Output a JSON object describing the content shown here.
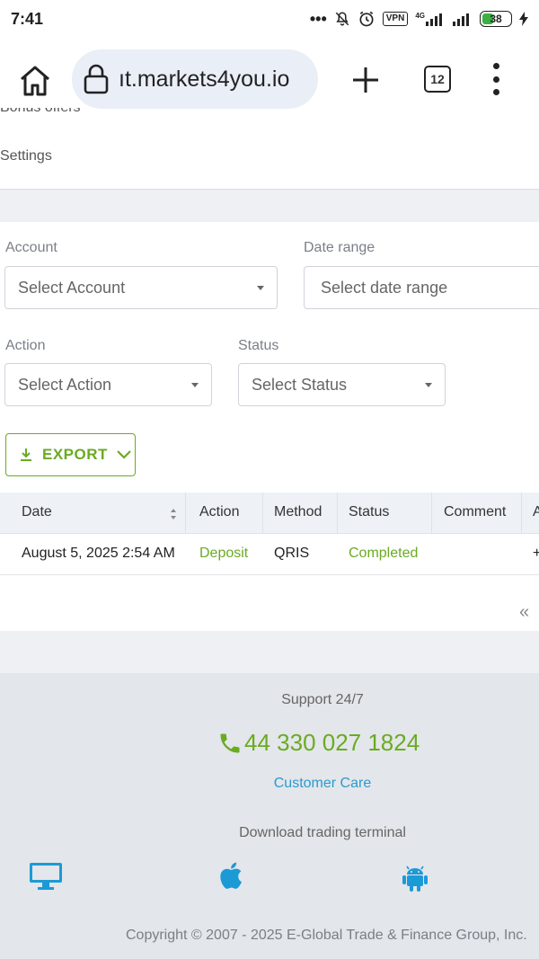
{
  "status_bar": {
    "time": "7:41",
    "icons": [
      "more-dots-icon",
      "bell-off-icon",
      "alarm-icon",
      "vpn-icon",
      "signal-4g-icon",
      "signal-icon",
      "battery-icon",
      "charging-icon"
    ],
    "vpn": "VPN",
    "network": "4G",
    "battery": "38"
  },
  "browser": {
    "url": "ıt.markets4you.io",
    "tab_count": "12"
  },
  "nav": {
    "bonus_partial": "Bonus offers",
    "settings": "Settings"
  },
  "filters": {
    "account_label": "Account",
    "account_value": "Select Account",
    "date_label": "Date range",
    "date_placeholder": "Select date range",
    "action_label": "Action",
    "action_value": "Select Action",
    "status_label": "Status",
    "status_value": "Select Status"
  },
  "export": {
    "label": "EXPORT"
  },
  "table": {
    "columns": [
      "Date",
      "Action",
      "Method",
      "Status",
      "Comment",
      "A"
    ],
    "rows": [
      {
        "date": "August 5, 2025 2:54 AM",
        "action": "Deposit",
        "method": "QRIS",
        "status": "Completed",
        "comment": "",
        "amount": "+"
      }
    ]
  },
  "pager": {
    "prev": "«"
  },
  "footer": {
    "support": "Support 24/7",
    "phone": "44 330 027 1824",
    "customer_care": "Customer Care",
    "download": "Download trading terminal",
    "copyright": "Copyright © 2007 - 2025 E-Global Trade & Finance Group, Inc."
  },
  "colors": {
    "accent_green": "#6aab22",
    "link_blue": "#2a9bd1",
    "icon_blue": "#1c9ad6"
  }
}
